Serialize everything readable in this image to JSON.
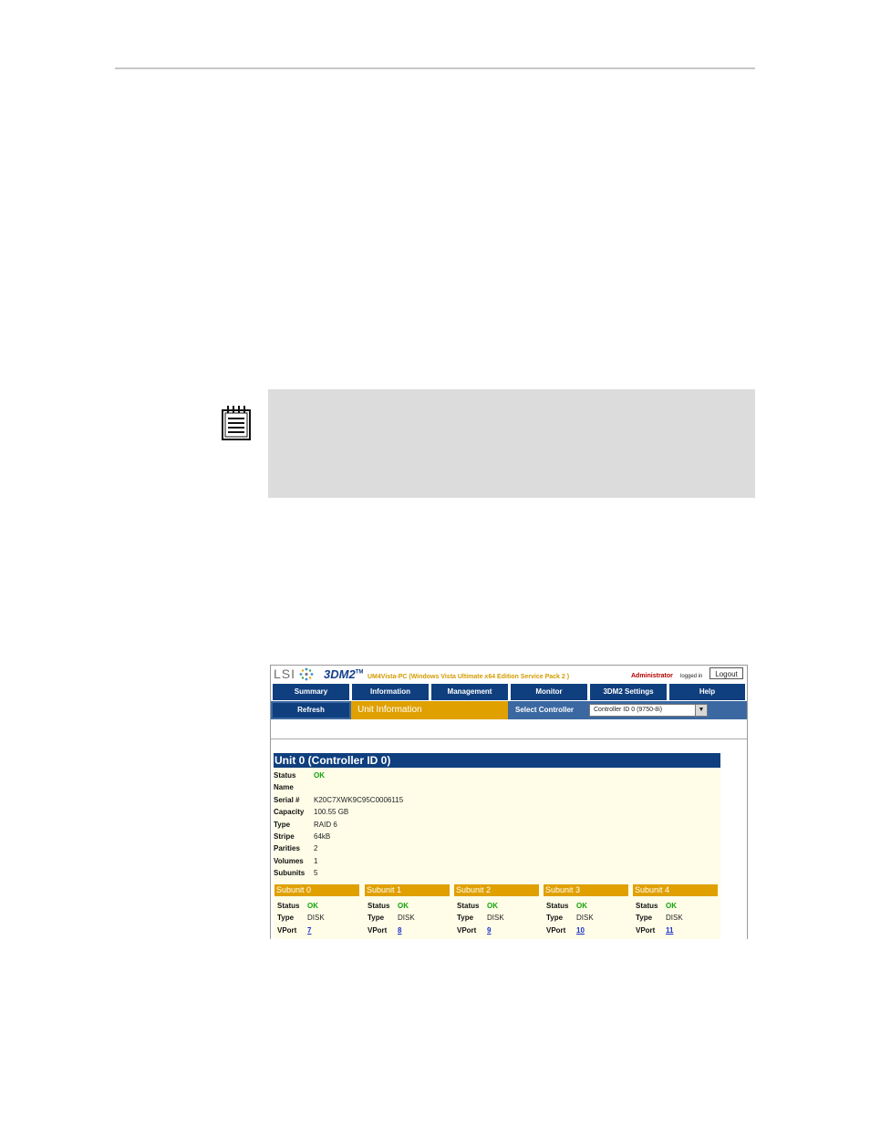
{
  "screenshot": {
    "logo_text": "LSI",
    "product": "3DM2",
    "trademark": "TM",
    "host_info": "UM4Vista-PC (Windows Vista Ultimate x64 Edition Service Pack 2 )",
    "user_role": "Administrator",
    "logged_in": "logged in",
    "logout_label": "Logout",
    "nav": [
      {
        "label": "Summary"
      },
      {
        "label": "Information"
      },
      {
        "label": "Management"
      },
      {
        "label": "Monitor"
      },
      {
        "label": "3DM2 Settings"
      },
      {
        "label": "Help"
      }
    ],
    "refresh_label": "Refresh",
    "current_page": "Unit Information",
    "select_controller_label": "Select Controller",
    "selected_controller": "Controller ID 0 (9750-8i)",
    "unit": {
      "title": "Unit 0 (Controller ID 0)",
      "fields": [
        {
          "key": "Status",
          "value": "OK"
        },
        {
          "key": "Name",
          "value": ""
        },
        {
          "key": "Serial #",
          "value": "K20C7XWK9C95C0006115"
        },
        {
          "key": "Capacity",
          "value": "100.55 GB"
        },
        {
          "key": "Type",
          "value": "RAID 6"
        },
        {
          "key": "Stripe",
          "value": "64kB"
        },
        {
          "key": "Parities",
          "value": "2"
        },
        {
          "key": "Volumes",
          "value": "1"
        },
        {
          "key": "Subunits",
          "value": "5"
        }
      ]
    },
    "subunit_labels": {
      "status": "Status",
      "type": "Type",
      "vport": "VPort"
    },
    "subunits": [
      {
        "title": "Subunit 0",
        "status": "OK",
        "type": "DISK",
        "vport": "7"
      },
      {
        "title": "Subunit 1",
        "status": "OK",
        "type": "DISK",
        "vport": "8"
      },
      {
        "title": "Subunit 2",
        "status": "OK",
        "type": "DISK",
        "vport": "9"
      },
      {
        "title": "Subunit 3",
        "status": "OK",
        "type": "DISK",
        "vport": "10"
      },
      {
        "title": "Subunit 4",
        "status": "OK",
        "type": "DISK",
        "vport": "11"
      }
    ]
  }
}
